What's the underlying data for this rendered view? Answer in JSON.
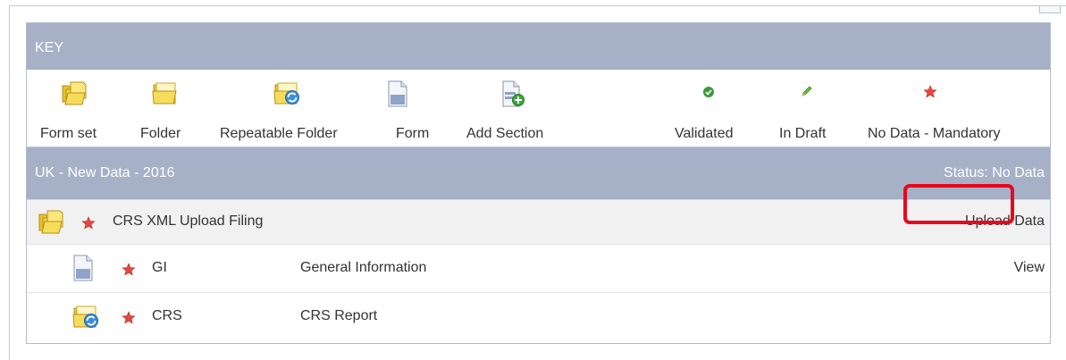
{
  "key": {
    "title": "KEY",
    "items": [
      {
        "label": "Form set",
        "icon": "form-set-icon"
      },
      {
        "label": "Folder",
        "icon": "folder-icon"
      },
      {
        "label": "Repeatable Folder",
        "icon": "repeatable-folder-icon"
      },
      {
        "label": "Form",
        "icon": "form-icon"
      },
      {
        "label": "Add Section",
        "icon": "add-section-icon"
      },
      {
        "label": "Validated",
        "icon": "validated-check-icon"
      },
      {
        "label": "In Draft",
        "icon": "draft-pencil-icon"
      },
      {
        "label": "No Data - Mandatory",
        "icon": "mandatory-star-icon"
      }
    ]
  },
  "filing": {
    "title": "UK - New Data - 2016",
    "status": "Status: No Data"
  },
  "rows": [
    {
      "code": "CRS XML Upload Filing",
      "description": "",
      "action": "Upload Data",
      "icon": "form-set-icon"
    },
    {
      "code": "GI",
      "description": "General Information",
      "action": "View",
      "icon": "form-icon"
    },
    {
      "code": "CRS",
      "description": "CRS Report",
      "action": "",
      "icon": "repeatable-folder-icon"
    }
  ],
  "colors": {
    "band": "#a6b1c8",
    "parent_row": "#f1f1f1",
    "highlight": "#e8081a",
    "star": "#e8453c",
    "check": "#3a9a3a"
  }
}
